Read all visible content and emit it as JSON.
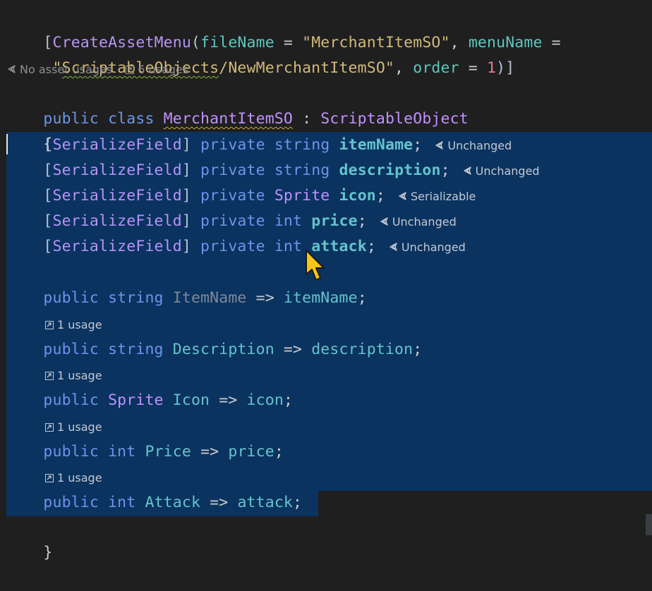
{
  "code": {
    "attribute_line1": {
      "open_bracket": "[",
      "attribute": "CreateAssetMenu",
      "open_paren": "(",
      "param1": "fileName",
      "eq1": " = ",
      "value1": "\"MerchantItemSO\"",
      "comma1": ", ",
      "param2": "menuName",
      "eq2": " ="
    },
    "attribute_line2": {
      "indent": " ",
      "quote_open": "\"",
      "value2_squiggle": "ScriptableObjects",
      "value2_rest": "/NewMerchantItemSO\"",
      "comma2": ", ",
      "param3": "order",
      "eq3": " = ",
      "value3": "1",
      "close": ")]"
    },
    "class_hints": {
      "asset_usages": "No asset usages",
      "usages": "6 usages"
    },
    "class_decl": {
      "kw_public": "public",
      "kw_class": "class",
      "class_name": "MerchantItemSO",
      "colon": " : ",
      "base_class": "ScriptableObject"
    },
    "open_brace": "{",
    "close_brace": "}",
    "fields": [
      {
        "attr_open": "[",
        "attr": "SerializeField",
        "attr_close": "]",
        "access": "private",
        "type": "string",
        "name": "itemName",
        "semi": ";",
        "hint": "Unchanged"
      },
      {
        "attr_open": "[",
        "attr": "SerializeField",
        "attr_close": "]",
        "access": "private",
        "type": "string",
        "name": "description",
        "semi": ";",
        "hint": "Unchanged"
      },
      {
        "attr_open": "[",
        "attr": "SerializeField",
        "attr_close": "]",
        "access": "private",
        "type": "Sprite",
        "name": "icon",
        "semi": ";",
        "hint": "Serializable"
      },
      {
        "attr_open": "[",
        "attr": "SerializeField",
        "attr_close": "]",
        "access": "private",
        "type": "int",
        "name": "price",
        "semi": ";",
        "hint": "Unchanged"
      },
      {
        "attr_open": "[",
        "attr": "SerializeField",
        "attr_close": "]",
        "access": "private",
        "type": "int",
        "name": "attack",
        "semi": ";",
        "hint": "Unchanged"
      }
    ],
    "properties": [
      {
        "access": "public",
        "type": "string",
        "name": "ItemName",
        "arrow": " => ",
        "ref": "itemName",
        "semi": ";",
        "usage_hint": "1 usage"
      },
      {
        "access": "public",
        "type": "string",
        "name": "Description",
        "arrow": " => ",
        "ref": "description",
        "semi": ";",
        "usage_hint": "1 usage"
      },
      {
        "access": "public",
        "type": "Sprite",
        "name": "Icon",
        "arrow": " => ",
        "ref": "icon",
        "semi": ";",
        "usage_hint": "1 usage"
      },
      {
        "access": "public",
        "type": "int",
        "name": "Price",
        "arrow": " => ",
        "ref": "price",
        "semi": ";",
        "usage_hint": "1 usage"
      },
      {
        "access": "public",
        "type": "int",
        "name": "Attack",
        "arrow": " => ",
        "ref": "attack",
        "semi": ";"
      }
    ]
  },
  "colors": {
    "background": "#1f1f1f",
    "selection": "#0a3360",
    "keyword": "#6c95eb",
    "type": "#c191ff",
    "identifier": "#66c3cc",
    "string": "#d2b97a",
    "number": "#e87a90",
    "mouse_cursor": "#f5c518"
  }
}
